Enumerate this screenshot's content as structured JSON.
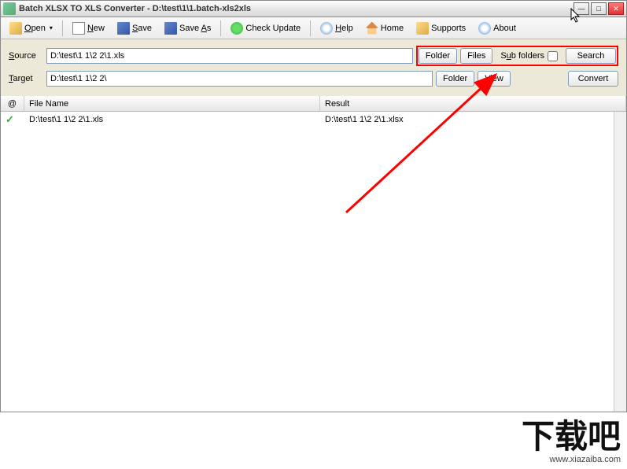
{
  "titlebar": {
    "title": "Batch XLSX TO XLS Converter - D:\\test\\1\\1.batch-xls2xls"
  },
  "toolbar": {
    "open": "Open",
    "new": "New",
    "save": "Save",
    "save_as": "Save As",
    "check_update": "Check Update",
    "help": "Help",
    "home": "Home",
    "supports": "Supports",
    "about": "About"
  },
  "form": {
    "source_label": "Source",
    "source_value": "D:\\test\\1 1\\2 2\\1.xls",
    "target_label": "Target",
    "target_value": "D:\\test\\1 1\\2 2\\",
    "folder_btn": "Folder",
    "files_btn": "Files",
    "sub_folders_label": "Sub folders",
    "search_btn": "Search",
    "view_btn": "View",
    "convert_btn": "Convert"
  },
  "list": {
    "header_status": "@",
    "header_filename": "File Name",
    "header_result": "Result",
    "rows": [
      {
        "file": "D:\\test\\1 1\\2 2\\1.xls",
        "result": "D:\\test\\1 1\\2 2\\1.xlsx"
      }
    ]
  },
  "watermark": {
    "text": "下载吧",
    "url": "www.xiazaiba.com"
  }
}
